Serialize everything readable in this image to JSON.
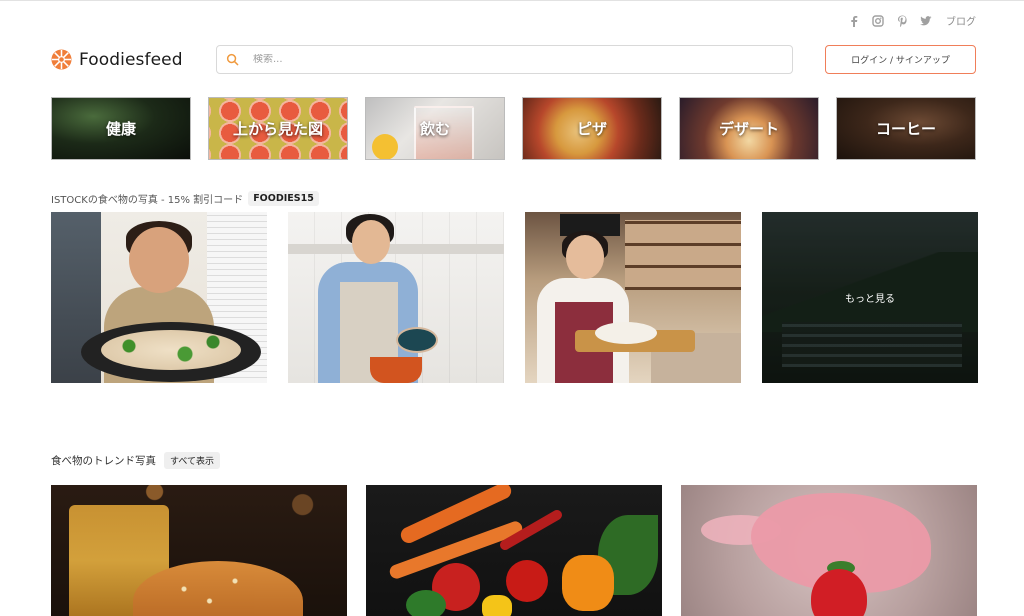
{
  "header": {
    "brand": "Foodiesfeed",
    "search_placeholder": "検索...",
    "login_label": "ログイン / サインアップ",
    "social": [
      "facebook-icon",
      "instagram-icon",
      "pinterest-icon",
      "twitter-icon"
    ],
    "blog_label": "ブログ"
  },
  "categories": [
    {
      "label": "健康"
    },
    {
      "label": "上から見た図"
    },
    {
      "label": "飲む"
    },
    {
      "label": "ピザ"
    },
    {
      "label": "デザート"
    },
    {
      "label": "コーヒー"
    }
  ],
  "istock": {
    "text": "ISTOCKの食べ物の写真 - 15% 割引コード",
    "code": "FOODIES15",
    "more_label": "もっと見る"
  },
  "trending": {
    "title": "食べ物のトレンド写真",
    "show_all": "すべて表示"
  },
  "colors": {
    "accent": "#f07e59",
    "text": "#222222",
    "muted": "#9a9a9a"
  }
}
